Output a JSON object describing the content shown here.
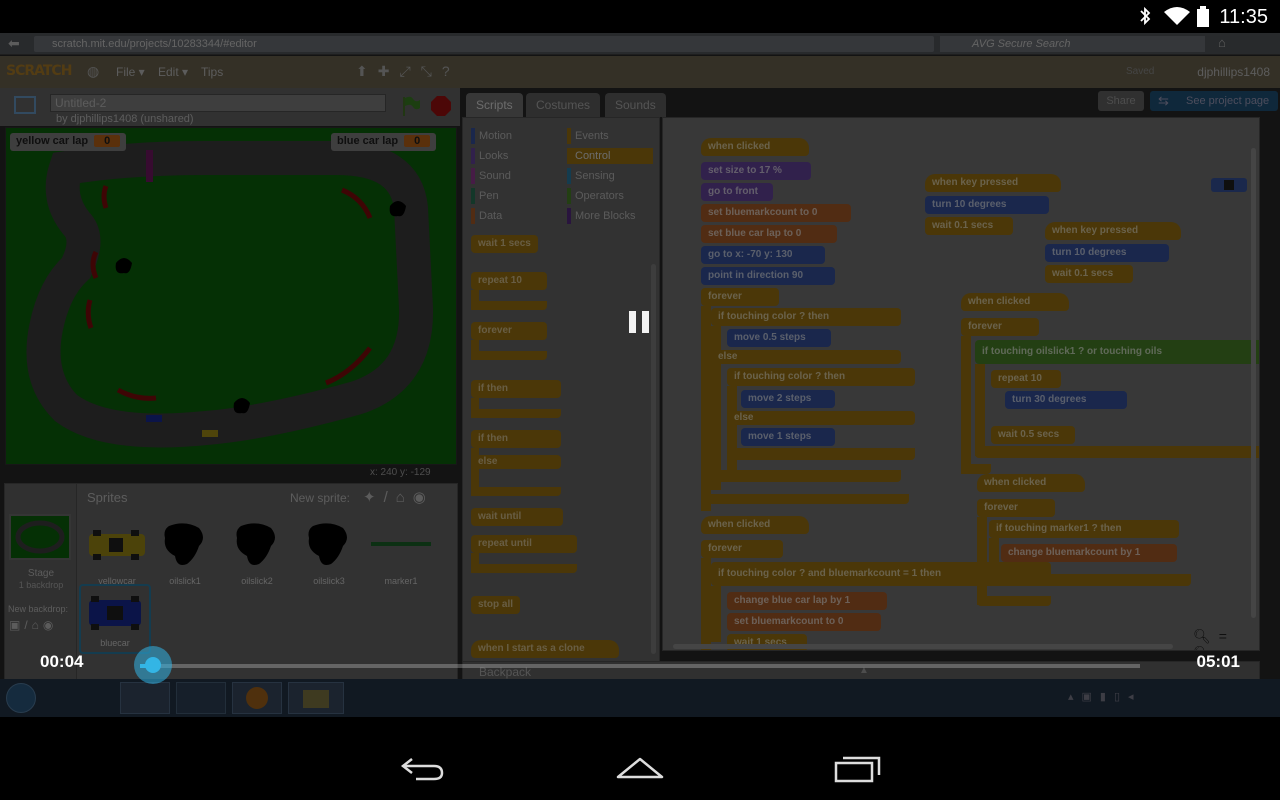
{
  "status_bar": {
    "time": "11:35",
    "icons": [
      "bluetooth-icon",
      "wifi-icon",
      "battery-icon"
    ]
  },
  "browser": {
    "url": "scratch.mit.edu/projects/10283344/#editor",
    "search_placeholder": "AVG Secure Search"
  },
  "scratch_menu": {
    "logo": "SCRATCH",
    "items": [
      "File ▾",
      "Edit ▾",
      "Tips"
    ],
    "saved_label": "Saved",
    "user": "djphillips1408"
  },
  "project": {
    "title": "Untitled-2",
    "byline": "by djphillips1408 (unshared)",
    "share_label": "Share",
    "see_project_label": "See project page"
  },
  "stage": {
    "monitors": [
      {
        "label": "yellow car lap",
        "value": "0"
      },
      {
        "label": "blue car lap",
        "value": "0"
      }
    ],
    "coords": "x: 240   y: -129"
  },
  "sprites": {
    "title": "Sprites",
    "new_sprite_label": "New sprite:",
    "stage_label": "Stage",
    "stage_sub": "1 backdrop",
    "new_backdrop_label": "New backdrop:",
    "items": [
      "yellowcar",
      "oilslick1",
      "oilslick2",
      "oilslick3",
      "marker1",
      "bluecar"
    ]
  },
  "tabs": [
    "Scripts",
    "Costumes",
    "Sounds"
  ],
  "categories": [
    {
      "name": "Motion",
      "color": "#3a57a8"
    },
    {
      "name": "Events",
      "color": "#a67b12"
    },
    {
      "name": "Looks",
      "color": "#6e4aa8"
    },
    {
      "name": "Control",
      "color": "#a67b12"
    },
    {
      "name": "Sound",
      "color": "#9b3f9b"
    },
    {
      "name": "Sensing",
      "color": "#2e86b0"
    },
    {
      "name": "Pen",
      "color": "#2b7a5c"
    },
    {
      "name": "Operators",
      "color": "#4f8d2a"
    },
    {
      "name": "Data",
      "color": "#b4622a"
    },
    {
      "name": "More Blocks",
      "color": "#5b2e8a"
    }
  ],
  "palette_blocks": [
    "wait 1 secs",
    "repeat 10",
    "forever",
    "if then",
    "if then",
    "else",
    "wait until",
    "repeat until",
    "stop all",
    "when I start as a clone"
  ],
  "scripts": {
    "s1": [
      "when clicked",
      "set size to 17 %",
      "go to front",
      "set bluemarkcount to 0",
      "set blue car lap to 0",
      "go to x: -70 y: 130",
      "point in direction 90",
      "forever",
      "if touching color ? then",
      "move 0.5 steps",
      "else",
      "if touching color ? then",
      "move 2 steps",
      "else",
      "move 1 steps"
    ],
    "s2": [
      "when clicked",
      "forever",
      "if touching color ? and bluemarkcount = 1 then",
      "change blue car lap by 1",
      "set bluemarkcount to 0",
      "wait 1 secs"
    ],
    "s3": [
      "when key pressed",
      "turn 10 degrees",
      "wait 0.1 secs"
    ],
    "s4": [
      "when key pressed",
      "turn 10 degrees",
      "wait 0.1 secs"
    ],
    "s5": [
      "when clicked",
      "forever",
      "if touching oilslick1 ? or touching oils",
      "repeat 10",
      "turn 30 degrees",
      "wait 0.5 secs"
    ],
    "s6": [
      "when clicked",
      "forever",
      "if touching marker1 ? then",
      "change bluemarkcount by 1"
    ]
  },
  "backpack_label": "Backpack",
  "player": {
    "current_time": "00:04",
    "total_time": "05:01",
    "progress_percent": 1.3
  }
}
